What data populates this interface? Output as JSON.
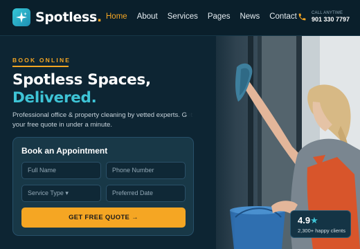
{
  "brand": {
    "name": "Spotless",
    "dot": ".",
    "logo_icon": "sparkle-icon"
  },
  "nav": [
    {
      "label": "Home",
      "active": true
    },
    {
      "label": "About"
    },
    {
      "label": "Services"
    },
    {
      "label": "Pages"
    },
    {
      "label": "News"
    },
    {
      "label": "Contact"
    }
  ],
  "contact": {
    "label": "CALL ANYTIME",
    "phone": "901 330 7797",
    "icon": "phone-icon"
  },
  "hero": {
    "eyebrow": "BOOK ONLINE",
    "title_line1": "Spotless Spaces,",
    "title_line2": "Delivered.",
    "subtext": "Professional office & property cleaning by vetted experts. Get your free quote in under a minute."
  },
  "booking": {
    "title": "Book an Appointment",
    "full_name_placeholder": "Full Name",
    "phone_placeholder": "Phone Number",
    "service_placeholder": "Service Type ▾",
    "date_placeholder": "Preferred Date",
    "cta": "GET FREE QUOTE →"
  },
  "rating": {
    "score": "4.9",
    "star": "★",
    "clients": "2,300+ happy clients"
  },
  "colors": {
    "accent": "#f5a623",
    "teal": "#3ec4d6",
    "background": "#0d2533"
  }
}
